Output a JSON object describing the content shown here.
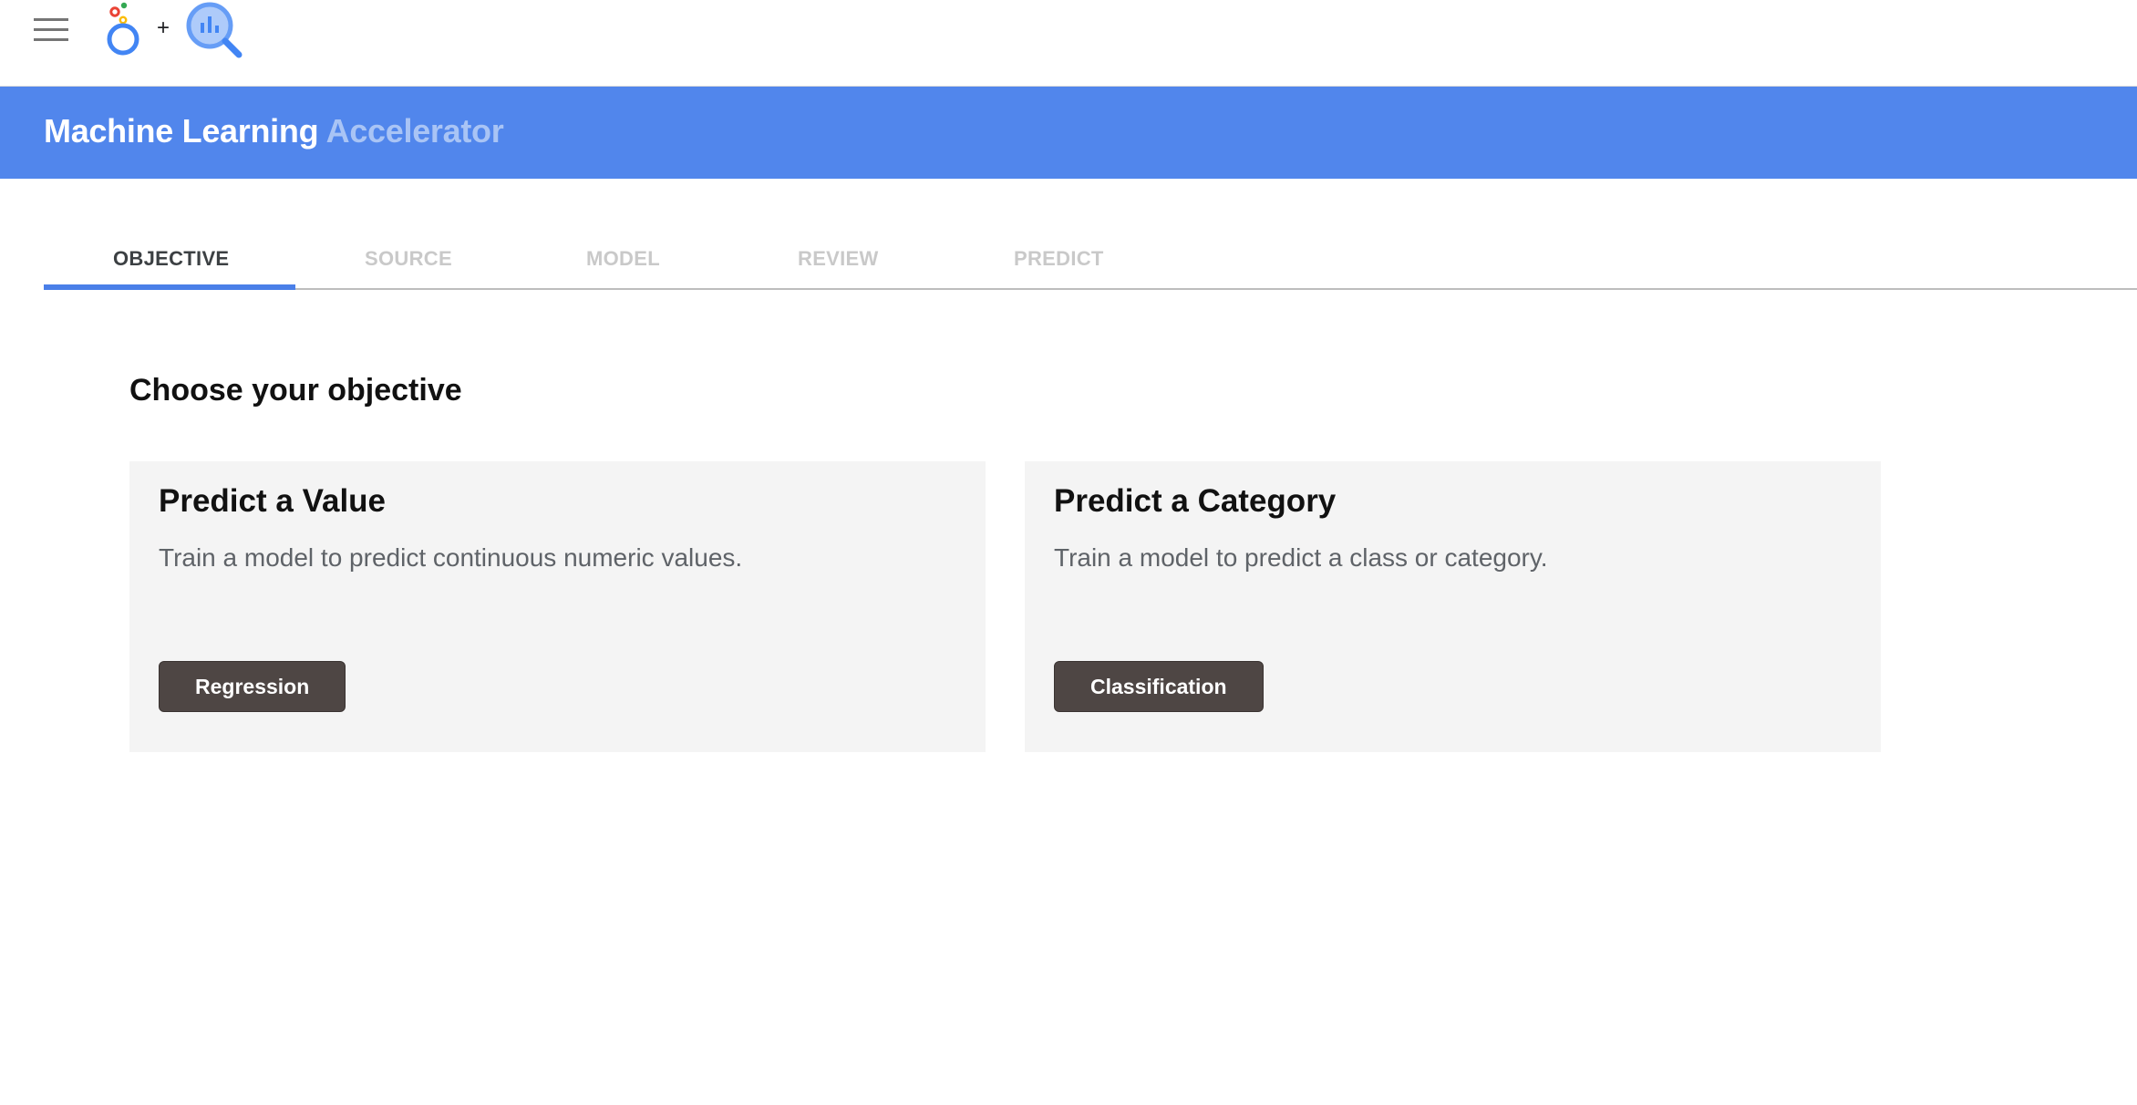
{
  "header": {
    "menu_icon": "hamburger-menu-icon",
    "logos": [
      "looker-logo",
      "bigquery-logo"
    ],
    "plus": "+"
  },
  "banner": {
    "title_primary": "Machine Learning",
    "title_secondary": "Accelerator",
    "background_color": "#5186ec"
  },
  "tabs": [
    {
      "label": "OBJECTIVE",
      "active": true
    },
    {
      "label": "SOURCE",
      "active": false
    },
    {
      "label": "MODEL",
      "active": false
    },
    {
      "label": "REVIEW",
      "active": false
    },
    {
      "label": "PREDICT",
      "active": false
    }
  ],
  "main": {
    "heading": "Choose your objective",
    "cards": [
      {
        "title": "Predict a Value",
        "description": "Train a model to predict continuous numeric values.",
        "button_label": "Regression"
      },
      {
        "title": "Predict a Category",
        "description": "Train a model to predict a class or category.",
        "button_label": "Classification"
      }
    ]
  },
  "colors": {
    "accent": "#4a7fe8",
    "button": "#4e4644",
    "card_background": "#f4f4f4"
  }
}
